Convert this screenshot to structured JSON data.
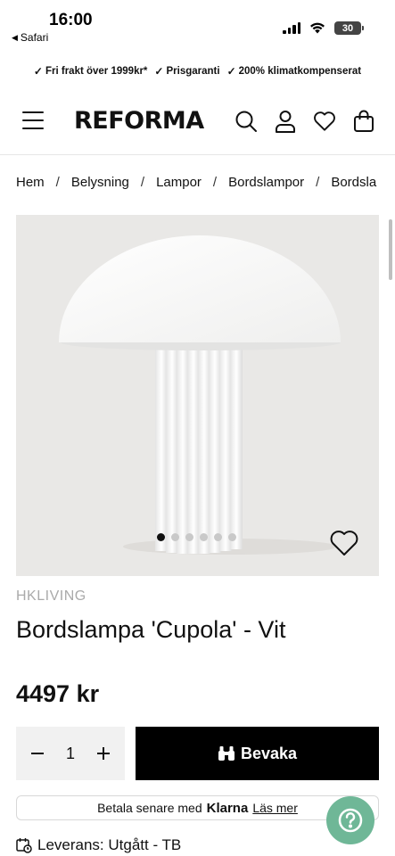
{
  "status": {
    "time": "16:00",
    "back_app": "Safari",
    "battery": "30"
  },
  "usp": [
    "Fri frakt över 1999kr*",
    "Prisgaranti",
    "200% klimatkompenserat"
  ],
  "header": {
    "logo": "REFORMA"
  },
  "breadcrumb": [
    "Hem",
    "Belysning",
    "Lampor",
    "Bordslampor",
    "Bordsla"
  ],
  "breadcrumb_sep": "/",
  "gallery": {
    "image_count": 6,
    "active_index": 0
  },
  "product": {
    "brand": "HKLIVING",
    "title": "Bordslampa 'Cupola' - Vit",
    "price": "4497 kr"
  },
  "purchase": {
    "quantity": "1",
    "cta_label": "Bevaka"
  },
  "klarna": {
    "text": "Betala senare med",
    "brand": "Klarna",
    "link": "Läs mer"
  },
  "delivery": {
    "text": "Leverans: Utgått - TB"
  },
  "colors": {
    "accent_help": "#6fb797",
    "cta_bg": "#000000",
    "image_bg": "#e9e8e6",
    "brand_text": "#aaaaaa"
  }
}
